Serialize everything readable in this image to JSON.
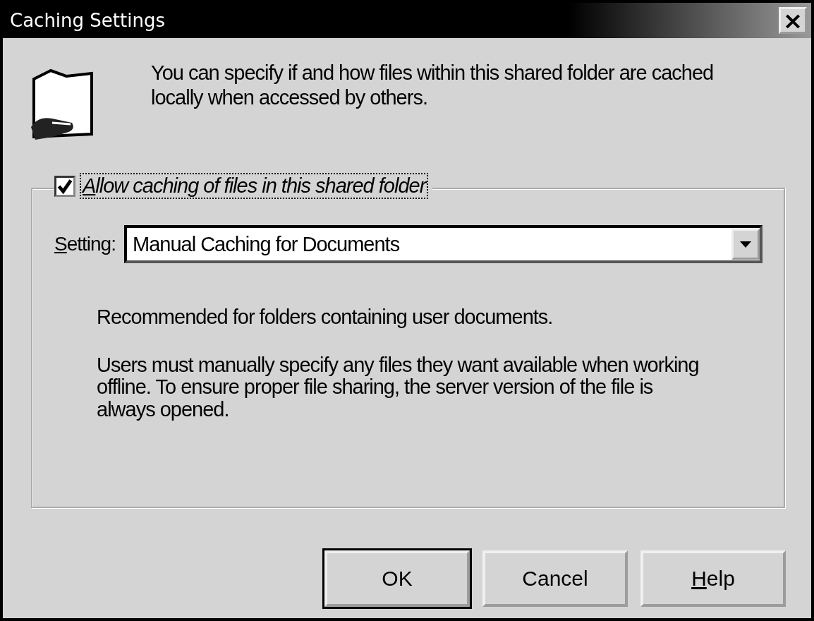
{
  "window": {
    "title": "Caching Settings",
    "close": "×"
  },
  "intro": "You can specify if and how files within this shared folder are cached locally when accessed by others.",
  "allow_caching": {
    "label": "Allow caching of files in this shared folder",
    "checked": true,
    "underline_first": true
  },
  "setting": {
    "label": "Setting:",
    "underline_first": true,
    "value": "Manual Caching for Documents"
  },
  "recommendation": "Recommended for folders containing user documents.",
  "description": "Users must manually specify any files they want available when working offline.  To ensure proper file sharing, the server version of the file is always opened.",
  "buttons": [
    {
      "label": "OK",
      "default": true,
      "underline_first": false
    },
    {
      "label": "Cancel",
      "default": false,
      "underline_first": false
    },
    {
      "label": "Help",
      "default": false,
      "underline_first": true
    }
  ]
}
